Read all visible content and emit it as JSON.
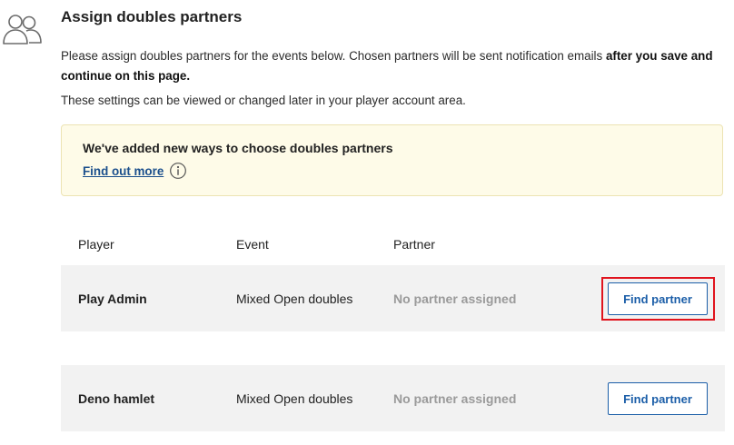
{
  "page": {
    "title": "Assign doubles partners",
    "intro_text": "Please assign doubles partners for the events below. Chosen partners will be sent notification emails ",
    "intro_bold": "after you save and continue on this page.",
    "settings_note": "These settings can be viewed or changed later in your player account area."
  },
  "banner": {
    "title": "We've added new ways to choose doubles partners",
    "link_label": "Find out more",
    "background": "#fefbe8",
    "border": "#ece3b3"
  },
  "table": {
    "headers": [
      "Player",
      "Event",
      "Partner"
    ],
    "rows": [
      {
        "player": "Play Admin",
        "event": "Mixed Open doubles",
        "partner": "No partner assigned",
        "action": "Find partner"
      },
      {
        "player": "Deno hamlet",
        "event": "Mixed Open doubles",
        "partner": "No partner assigned",
        "action": "Find partner"
      }
    ]
  },
  "icons": {
    "header": "people-icon",
    "info": "info-icon"
  },
  "colors": {
    "link": "#1b4f8c",
    "button": "#1b5ea8",
    "highlight": "#e0141e",
    "row_bg": "#f2f2f2",
    "muted": "#9a9a9a"
  }
}
